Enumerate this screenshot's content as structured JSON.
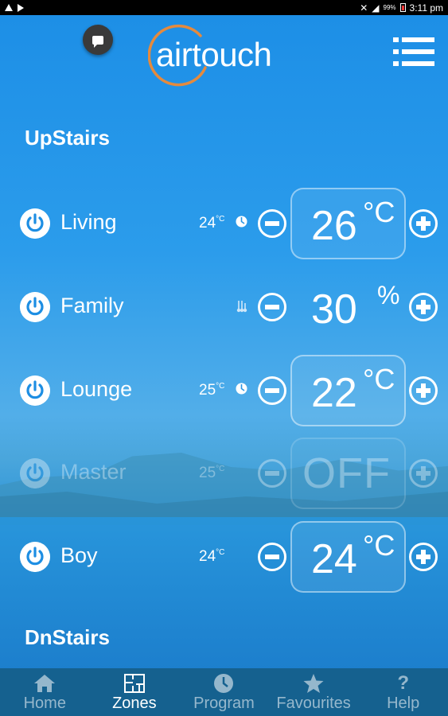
{
  "status_bar": {
    "battery": "99%",
    "time": "3:11 pm"
  },
  "header": {
    "logo_text": "airtouch"
  },
  "sections": [
    {
      "title": "UpStairs",
      "zones": [
        {
          "name": "Living",
          "current_temp": "24",
          "current_unit": "°C",
          "indicator": "clock-icon",
          "setpoint": "26",
          "unit": "°C",
          "state": "on"
        },
        {
          "name": "Family",
          "current_temp": "",
          "current_unit": "",
          "indicator": "humidity-icon",
          "setpoint": "30",
          "unit": "%",
          "state": "on"
        },
        {
          "name": "Lounge",
          "current_temp": "25",
          "current_unit": "°C",
          "indicator": "clock-icon",
          "setpoint": "22",
          "unit": "°C",
          "state": "on"
        },
        {
          "name": "Master",
          "current_temp": "25",
          "current_unit": "°C",
          "indicator": "",
          "setpoint": "OFF",
          "unit": "",
          "state": "off"
        },
        {
          "name": "Boy",
          "current_temp": "24",
          "current_unit": "°C",
          "indicator": "",
          "setpoint": "24",
          "unit": "°C",
          "state": "on"
        }
      ]
    },
    {
      "title": "DnStairs",
      "zones": []
    }
  ],
  "tabs": [
    {
      "label": "Home",
      "icon": "home-icon",
      "active": false
    },
    {
      "label": "Zones",
      "icon": "floorplan-icon",
      "active": true
    },
    {
      "label": "Program",
      "icon": "clock-icon",
      "active": false
    },
    {
      "label": "Favourites",
      "icon": "star-icon",
      "active": false
    },
    {
      "label": "Help",
      "icon": "question-icon",
      "active": false
    }
  ],
  "colors": {
    "accent_ring": "#e58a3d",
    "tabbar": "#15618f",
    "background": "#1f8fe3"
  }
}
